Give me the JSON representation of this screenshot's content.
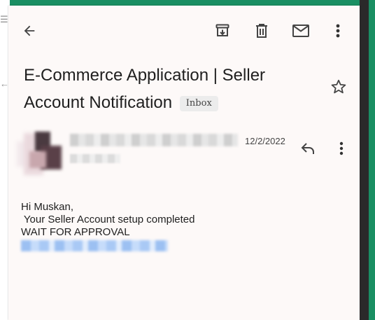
{
  "toolbar": {
    "back_icon": "arrow-back-icon",
    "archive_icon": "archive-icon",
    "delete_icon": "delete-icon",
    "mark_unread_icon": "mail-icon",
    "more_icon": "more-vertical-icon"
  },
  "email": {
    "subject": "E-Commerce Application | Seller Account Notification",
    "label_badge": "Inbox",
    "starred": false,
    "date": "12/2/2022",
    "body_lines": [
      "Hi Muskan,",
      " Your Seller Account setup completed",
      "WAIT FOR APPROVAL"
    ]
  },
  "colors": {
    "frame_bg": "#1a8f63",
    "screen_bg": "#fdf9f8",
    "text": "#1f1f1f",
    "badge_bg": "#ececec"
  }
}
